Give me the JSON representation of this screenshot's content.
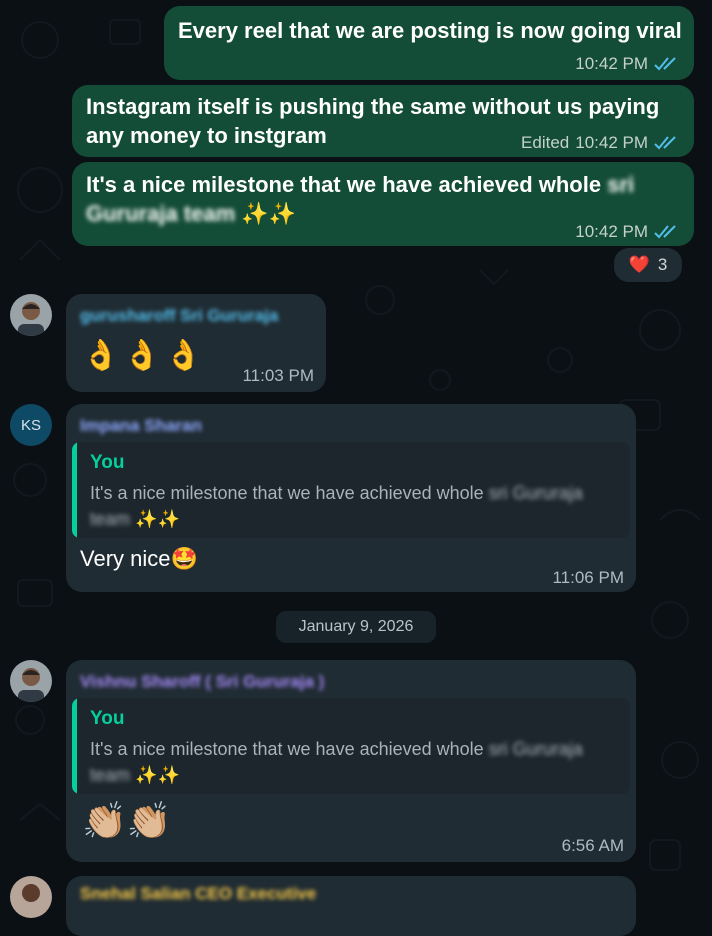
{
  "messages": {
    "m1": {
      "text": "Every reel that we are posting is now going viral",
      "time": "10:42 PM"
    },
    "m2": {
      "text": "Instagram itself is pushing the same without us paying any money to instgram",
      "edited": "Edited",
      "time": "10:42 PM"
    },
    "m3": {
      "text_main": "It's a nice milestone that we have achieved whole",
      "text_blur": "sri Gururaja team",
      "emoji": "✨✨",
      "time": "10:42 PM",
      "reaction_emoji": "❤️",
      "reaction_count": "3"
    },
    "m4": {
      "sender": "gurusharoff Sri Gururaja",
      "emoji": "👌👌👌",
      "time": "11:03 PM"
    },
    "m5": {
      "avatar_initials": "KS",
      "sender": "Impana Sharan",
      "quote_author": "You",
      "quote_text": "It's a nice milestone that we have achieved whole",
      "quote_blur": "sri Gururaja team",
      "quote_emoji": "✨✨",
      "text": "Very nice🤩",
      "time": "11:06 PM"
    },
    "date_divider": "January 9, 2026",
    "m6": {
      "sender": "Vishnu Sharoff ( Sri Gururaja )",
      "quote_author": "You",
      "quote_text": "It's a nice milestone that we have achieved whole",
      "quote_blur": "sri Gururaja team",
      "quote_emoji": "✨✨",
      "emoji": "👏🏼👏🏼",
      "time": "6:56 AM"
    },
    "m7": {
      "sender": "Snehal Salian CEO Executive"
    }
  },
  "colors": {
    "outgoing_bubble": "#144d37",
    "incoming_bubble": "#202c33",
    "background": "#0b1014",
    "read_ticks": "#53bdeb",
    "sender_1": "#53bdeb",
    "sender_2": "#8fa8ff",
    "sender_3": "#a78bfa",
    "sender_4": "#f7c948"
  }
}
